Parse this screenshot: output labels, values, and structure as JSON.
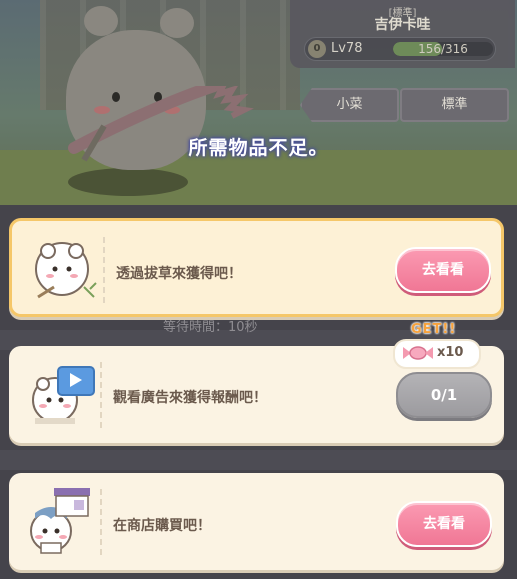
{
  "player": {
    "title": "[標準]",
    "name": "吉伊卡哇",
    "level_badge": "0",
    "level": "Lv78",
    "exp_text": "156/316",
    "exp_fraction": 0.494
  },
  "tabs": {
    "small_dish": "小菜",
    "standard": "標準"
  },
  "background": {
    "wait_time": "等待時間：10秒"
  },
  "message": "所需物品不足。",
  "options": [
    {
      "label": "透過拔草來獲得吧！",
      "button": "去看看"
    },
    {
      "label": "觀看廣告來獲得報酬吧！",
      "button": "0/1",
      "get_badge": "GET!!",
      "reward_count": "x10"
    },
    {
      "label": "在商店購買吧！",
      "button": "去看看"
    }
  ],
  "colors": {
    "pink_button": "#f07795",
    "gray_button": "#9c9b9f",
    "card_bg": "#fbf3e3",
    "highlight_border": "#f5c769"
  },
  "icons": [
    "level-icon",
    "candy-icon",
    "tv-play-icon",
    "shop-icon",
    "weed-sickle-icon"
  ]
}
